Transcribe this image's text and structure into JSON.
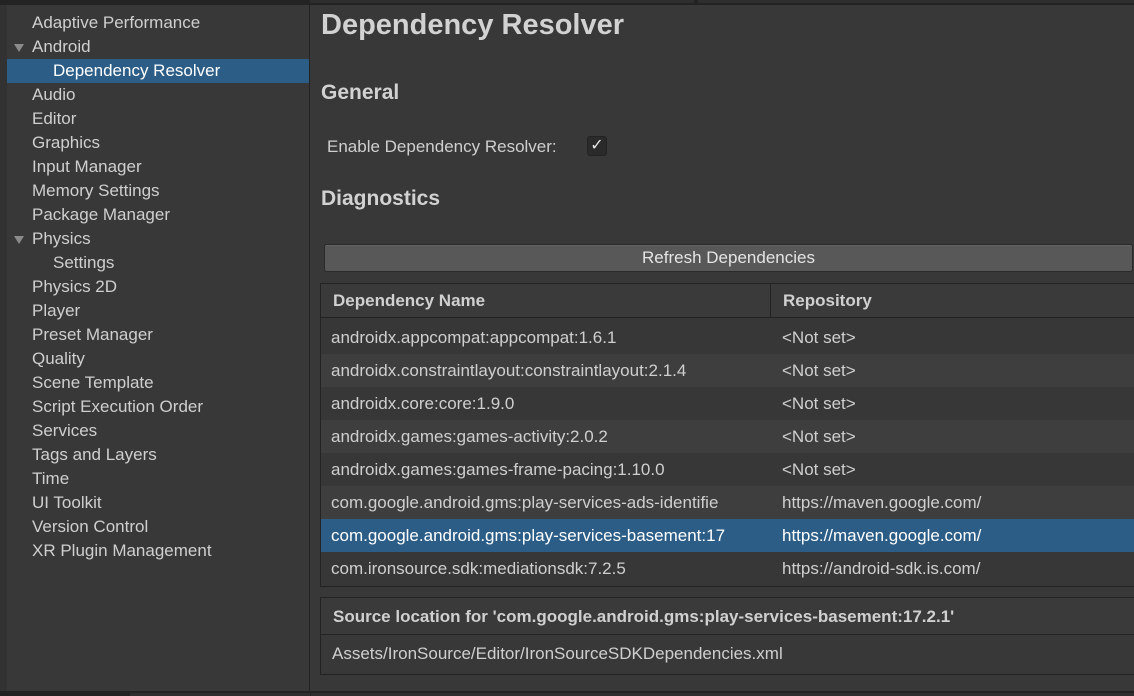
{
  "sidebar": {
    "items": [
      {
        "label": "Adaptive Performance"
      },
      {
        "label": "Android",
        "expanded": true
      },
      {
        "label": "Dependency Resolver",
        "selected": true
      },
      {
        "label": "Audio"
      },
      {
        "label": "Editor"
      },
      {
        "label": "Graphics"
      },
      {
        "label": "Input Manager"
      },
      {
        "label": "Memory Settings"
      },
      {
        "label": "Package Manager"
      },
      {
        "label": "Physics",
        "expanded": true
      },
      {
        "label": "Settings"
      },
      {
        "label": "Physics 2D"
      },
      {
        "label": "Player"
      },
      {
        "label": "Preset Manager"
      },
      {
        "label": "Quality"
      },
      {
        "label": "Scene Template"
      },
      {
        "label": "Script Execution Order"
      },
      {
        "label": "Services"
      },
      {
        "label": "Tags and Layers"
      },
      {
        "label": "Time"
      },
      {
        "label": "UI Toolkit"
      },
      {
        "label": "Version Control"
      },
      {
        "label": "XR Plugin Management"
      }
    ]
  },
  "main": {
    "title": "Dependency Resolver",
    "general_heading": "General",
    "enable_label": "Enable Dependency Resolver:",
    "enable_checked": true,
    "checkmark": "✓",
    "diagnostics_heading": "Diagnostics",
    "refresh_button": "Refresh Dependencies",
    "table": {
      "columns": [
        "Dependency Name",
        "Repository"
      ],
      "rows": [
        {
          "name": "androidx.appcompat:appcompat:1.6.1",
          "repo": "<Not set>"
        },
        {
          "name": "androidx.constraintlayout:constraintlayout:2.1.4",
          "repo": "<Not set>"
        },
        {
          "name": "androidx.core:core:1.9.0",
          "repo": "<Not set>"
        },
        {
          "name": "androidx.games:games-activity:2.0.2",
          "repo": "<Not set>"
        },
        {
          "name": "androidx.games:games-frame-pacing:1.10.0",
          "repo": "<Not set>"
        },
        {
          "name": "com.google.android.gms:play-services-ads-identifie",
          "repo": "https://maven.google.com/"
        },
        {
          "name": "com.google.android.gms:play-services-basement:17",
          "repo": "https://maven.google.com/",
          "selected": true
        },
        {
          "name": "com.ironsource.sdk:mediationsdk:7.2.5",
          "repo": "https://android-sdk.is.com/"
        }
      ]
    },
    "source_location_heading": "Source location for 'com.google.android.gms:play-services-basement:17.2.1'",
    "source_location_path": "Assets/IronSource/Editor/IronSourceSDKDependencies.xml"
  },
  "colors": {
    "background": "#383838",
    "selection": "#2c5d87",
    "border": "#232323",
    "text": "#cfcfcf"
  }
}
